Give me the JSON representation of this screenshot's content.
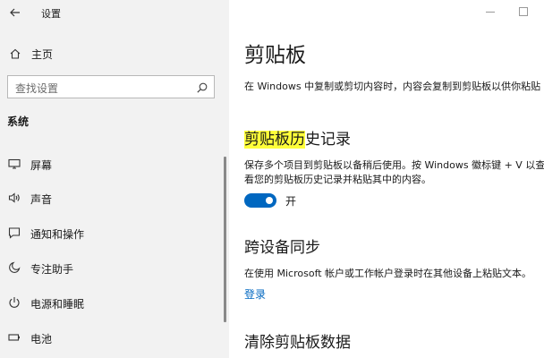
{
  "window": {
    "app_title": "设置",
    "back_icon": "back-arrow-icon",
    "minimize_icon": "minimize-icon",
    "maximize_icon": "maximize-icon"
  },
  "sidebar": {
    "home_label": "主页",
    "home_icon": "home-icon",
    "search_placeholder": "查找设置",
    "search_icon": "search-icon",
    "section_title": "系统",
    "items": [
      {
        "label": "屏幕",
        "icon": "display-icon"
      },
      {
        "label": "声音",
        "icon": "speaker-icon"
      },
      {
        "label": "通知和操作",
        "icon": "notification-icon"
      },
      {
        "label": "专注助手",
        "icon": "moon-icon"
      },
      {
        "label": "电源和睡眠",
        "icon": "power-icon"
      },
      {
        "label": "电池",
        "icon": "battery-icon"
      }
    ]
  },
  "main": {
    "title": "剪贴板",
    "intro": "在 Windows 中复制或剪切内容时，内容会复制到剪贴板以供你粘贴",
    "history": {
      "heading_highlight": "剪贴板历",
      "heading_rest": "史记录",
      "desc_line1": "保存多个项目到剪贴板以备稍后使用。按 Windows 徽标键 + V 以查",
      "desc_line2": "看您的剪贴板历史记录并粘贴其中的内容。",
      "toggle_label": "开",
      "toggle_on": true
    },
    "sync": {
      "heading": "跨设备同步",
      "desc": "在使用 Microsoft 帐户或工作帐户登录时在其他设备上粘贴文本。",
      "link": "登录"
    },
    "clear": {
      "heading": "清除剪贴板数据"
    }
  },
  "colors": {
    "accent": "#0067c0",
    "sidebar_bg": "#f2f2f2",
    "highlight": "#ffff3a"
  }
}
